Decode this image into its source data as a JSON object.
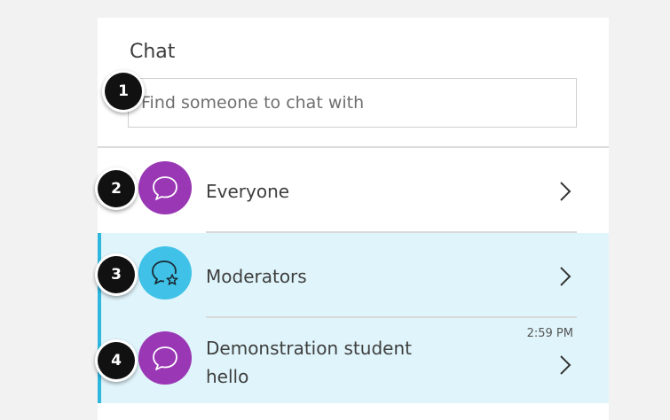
{
  "chat": {
    "title": "Chat",
    "search": {
      "placeholder": "Find someone to chat with"
    }
  },
  "rows": [
    {
      "label": "Everyone",
      "icon": "speech-bubble-icon",
      "avatar_color": "#9a37b5"
    },
    {
      "label": "Moderators",
      "icon": "speech-bubble-star-icon",
      "avatar_color": "#40c2e8",
      "highlighted": true
    },
    {
      "label": "Demonstration student",
      "message": "hello",
      "time": "2:59 PM",
      "icon": "speech-bubble-icon",
      "avatar_color": "#9a37b5",
      "highlighted": true
    }
  ],
  "callouts": [
    "1",
    "2",
    "3",
    "4"
  ],
  "colors": {
    "highlight_bg": "#e0f5fb",
    "accent": "#2fb7de",
    "purple": "#9a37b5",
    "blue": "#40c2e8"
  }
}
